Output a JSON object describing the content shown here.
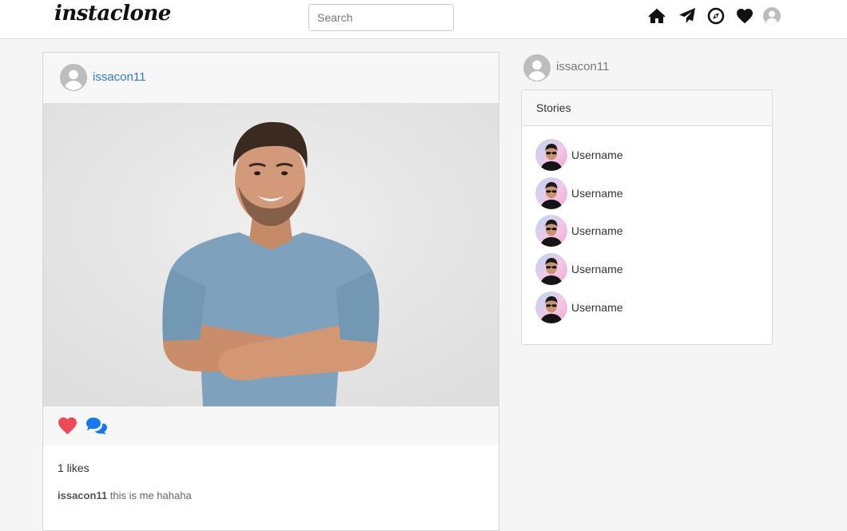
{
  "navbar": {
    "brand": "instaclone",
    "search_placeholder": "Search",
    "icons": [
      "home-icon",
      "send-icon",
      "compass-icon",
      "heart-icon",
      "profile-avatar-icon"
    ]
  },
  "post": {
    "username": "issacon11",
    "likes_text": "1 likes",
    "caption_user": "issacon11",
    "caption_text": "this is me hahaha",
    "like_color": "#ed4956",
    "comment_color": "#1877f2"
  },
  "sidebar": {
    "username": "issacon11",
    "stories_title": "Stories",
    "stories": [
      {
        "name": "Username"
      },
      {
        "name": "Username"
      },
      {
        "name": "Username"
      },
      {
        "name": "Username"
      },
      {
        "name": "Username"
      }
    ]
  },
  "colors": {
    "link": "#2d7dd2",
    "background": "#f5f5f5"
  }
}
